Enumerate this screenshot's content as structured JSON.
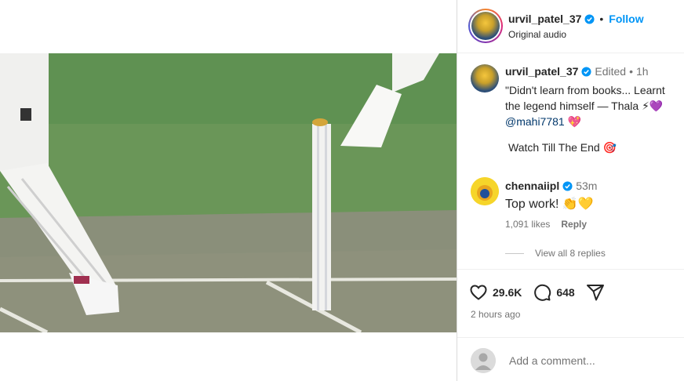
{
  "post_header": {
    "username": "urvil_patel_37",
    "separator": "•",
    "follow_label": "Follow",
    "audio_label": "Original audio"
  },
  "caption": {
    "username": "urvil_patel_37",
    "edited_label": "Edited",
    "separator": "•",
    "age": "1h",
    "text_line1": "\"Didn't learn from books... Learnt",
    "text_line2": "the legend himself — Thala",
    "emoji_line2": "⚡💜",
    "mention": "@mahi7781",
    "mention_emoji": "💖",
    "closing_line": "Watch Till The End 🎯"
  },
  "comment": {
    "username": "chennaiipl",
    "age": "53m",
    "text": "Top work! 👏💛",
    "likes_label": "1,091 likes",
    "reply_label": "Reply",
    "view_replies_label": "View all 8 replies"
  },
  "actions": {
    "like_count": "29.6K",
    "comment_count": "648",
    "posted_ago": "2 hours ago"
  },
  "add_comment": {
    "placeholder": "Add a comment..."
  },
  "icons": {
    "verified": "verified-badge-icon",
    "like": "heart-icon",
    "comment": "comment-bubble-icon",
    "share": "paper-plane-icon",
    "mute": "speaker-icon"
  },
  "colors": {
    "verified_blue": "#0095f6",
    "follow_blue": "#0095f6",
    "mention_blue": "#00376b",
    "muted_text": "#737373"
  }
}
